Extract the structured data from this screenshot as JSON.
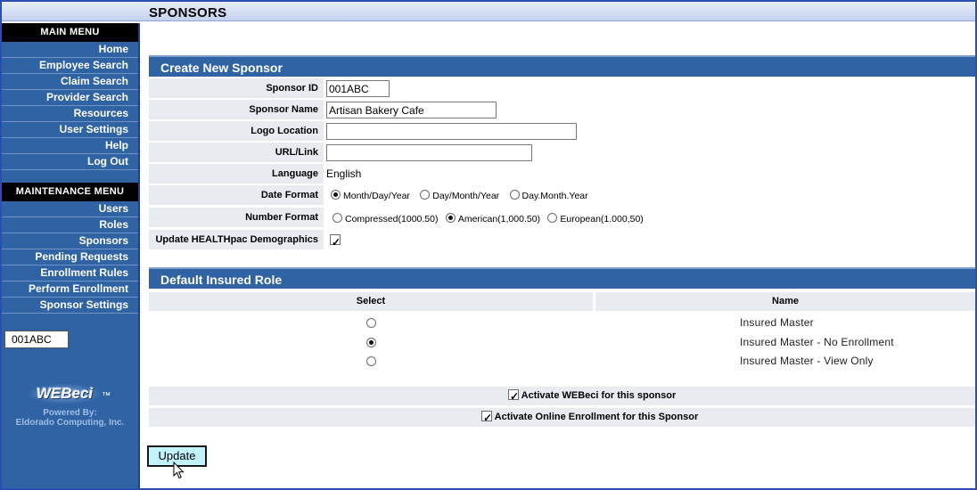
{
  "page": {
    "title": "SPONSORS"
  },
  "sidebar": {
    "main_menu_title": "MAIN MENU",
    "main_items": [
      "Home",
      "Employee Search",
      "Claim Search",
      "Provider Search",
      "Resources",
      "User Settings",
      "Help",
      "Log Out"
    ],
    "maintenance_title": "MAINTENANCE MENU",
    "maintenance_items": [
      "Users",
      "Roles",
      "Sponsors",
      "Pending Requests",
      "Enrollment Rules",
      "Perform Enrollment",
      "Sponsor Settings"
    ],
    "current_sponsor": "001ABC",
    "logo_text": "WEBeci",
    "logo_tm": "™",
    "powered_by": "Powered By:",
    "company": "Eldorado Computing, Inc."
  },
  "create": {
    "heading": "Create New Sponsor",
    "sponsor_id_label": "Sponsor ID",
    "sponsor_id_value": "001ABC",
    "sponsor_name_label": "Sponsor Name",
    "sponsor_name_value": "Artisan Bakery Cafe",
    "logo_location_label": "Logo Location",
    "logo_location_value": "",
    "url_label": "URL/Link",
    "url_value": "",
    "language_label": "Language",
    "language_value": "English",
    "date_format_label": "Date Format",
    "date_formats": [
      {
        "label": "Month/Day/Year",
        "selected": true
      },
      {
        "label": "Day/Month/Year",
        "selected": false
      },
      {
        "label": "Day.Month.Year",
        "selected": false
      }
    ],
    "number_format_label": "Number Format",
    "number_formats": [
      {
        "label": "Compressed(1000.50)",
        "selected": false
      },
      {
        "label": "American(1,000.50)",
        "selected": true
      },
      {
        "label": "European(1.000,50)",
        "selected": false
      }
    ],
    "update_demographics_label": "Update HEALTHpac Demographics",
    "update_demographics_checked": true
  },
  "role": {
    "heading": "Default Insured Role",
    "col_select": "Select",
    "col_name": "Name",
    "rows": [
      {
        "name": "Insured Master",
        "selected": false
      },
      {
        "name": "Insured Master - No Enrollment",
        "selected": true
      },
      {
        "name": "Insured Master - View Only",
        "selected": false
      }
    ],
    "activate_webeci_label": "Activate WEBeci for this sponsor",
    "activate_webeci_checked": true,
    "activate_enrollment_label": "Activate Online Enrollment for this Sponsor",
    "activate_enrollment_checked": true
  },
  "actions": {
    "update_label": "Update"
  },
  "colors": {
    "sidebar": "#2f63a3",
    "header_bar": "#2f63a3",
    "label_bg": "#e8ecf1",
    "button_bg": "#c2f4ff"
  }
}
